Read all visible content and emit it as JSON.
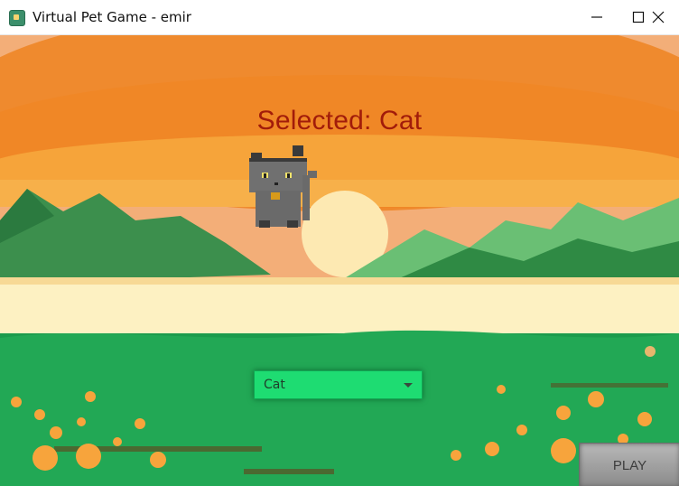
{
  "window": {
    "title": "Virtual Pet Game - emir",
    "controls": [
      "minimize-icon",
      "maximize-icon",
      "close-icon"
    ]
  },
  "scene": {
    "selected_text": "Selected: Cat",
    "pet": "cat",
    "colors": {
      "sky_top": "#f3ae78",
      "sky_mid": "#ef8a2e",
      "sky_band": "#f39c2f",
      "sun": "#fde9b2",
      "lake": "#fdf1c2",
      "mountain_dark": "#1d7a3c",
      "mountain_light": "#6abf74",
      "grass": "#1b9b4c",
      "flower": "#f7a43c",
      "label": "#a21c0a"
    }
  },
  "controls": {
    "pet_select_value": "Cat",
    "pet_select_options": [
      "Cat"
    ],
    "play_label": "PLAY"
  }
}
